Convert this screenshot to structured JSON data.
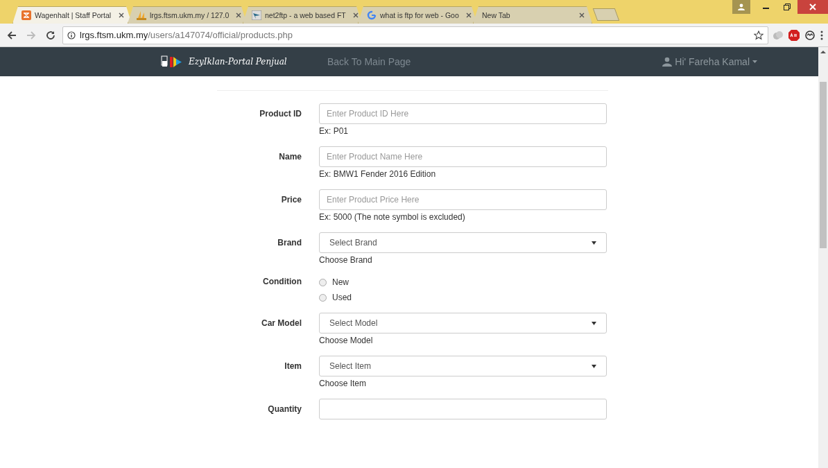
{
  "browser": {
    "tabs": [
      {
        "title": "Wagenhalt | Staff Portal",
        "selected": true
      },
      {
        "title": "lrgs.ftsm.ukm.my / 127.0",
        "selected": false
      },
      {
        "title": "net2ftp - a web based FT",
        "selected": false
      },
      {
        "title": "what is ftp for web - Goo",
        "selected": false
      },
      {
        "title": "New Tab",
        "selected": false
      }
    ],
    "address": {
      "host": "lrgs.ftsm.ukm.my",
      "path": "/users/a147074/official/products.php"
    }
  },
  "navbar": {
    "brand": "EzyIklan-Portal Penjual",
    "link": "Back To Main Page",
    "user": "Hi' Fareha Kamal"
  },
  "form": {
    "fields": [
      {
        "kind": "text",
        "label": "Product ID",
        "placeholder": "Enter Product ID Here",
        "hint": "Ex: P01"
      },
      {
        "kind": "text",
        "label": "Name",
        "placeholder": "Enter Product Name Here",
        "hint": "Ex: BMW1 Fender 2016 Edition"
      },
      {
        "kind": "text",
        "label": "Price",
        "placeholder": "Enter Product Price Here",
        "hint": "Ex: 5000 (The note symbol is excluded)"
      },
      {
        "kind": "select",
        "label": "Brand",
        "value": "Select Brand",
        "hint": "Choose Brand"
      },
      {
        "kind": "radio",
        "label": "Condition",
        "options": [
          {
            "label": "New",
            "selected": false
          },
          {
            "label": "Used",
            "selected": false
          }
        ]
      },
      {
        "kind": "select",
        "label": "Car Model",
        "value": "Select Model",
        "hint": "Choose Model"
      },
      {
        "kind": "select",
        "label": "Item",
        "value": "Select Item",
        "hint": "Choose Item"
      },
      {
        "kind": "text",
        "label": "Quantity"
      }
    ]
  }
}
